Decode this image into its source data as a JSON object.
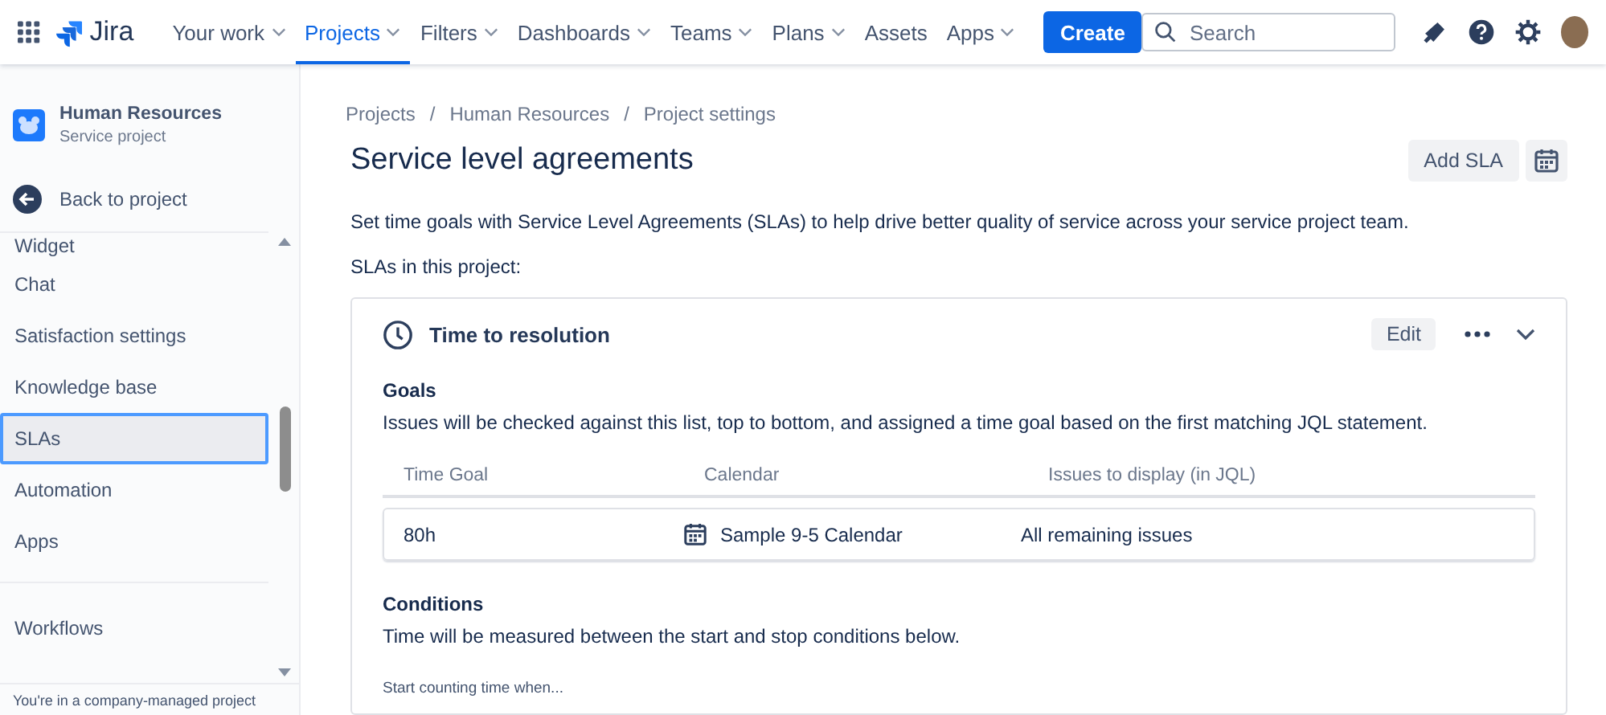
{
  "app": {
    "name": "Jira"
  },
  "nav": [
    {
      "label": "Your work",
      "dropdown": true,
      "selected": false
    },
    {
      "label": "Projects",
      "dropdown": true,
      "selected": true
    },
    {
      "label": "Filters",
      "dropdown": true,
      "selected": false
    },
    {
      "label": "Dashboards",
      "dropdown": true,
      "selected": false
    },
    {
      "label": "Teams",
      "dropdown": true,
      "selected": false
    },
    {
      "label": "Plans",
      "dropdown": true,
      "selected": false
    },
    {
      "label": "Assets",
      "dropdown": false,
      "selected": false
    },
    {
      "label": "Apps",
      "dropdown": true,
      "selected": false
    }
  ],
  "create_button": "Create",
  "search": {
    "placeholder": "Search"
  },
  "sidebar": {
    "project": {
      "name": "Human Resources",
      "type": "Service project"
    },
    "back": "Back to project",
    "items": [
      {
        "label": "Widget",
        "selected": false
      },
      {
        "label": "Chat",
        "selected": false
      },
      {
        "label": "Satisfaction settings",
        "selected": false
      },
      {
        "label": "Knowledge base",
        "selected": false
      },
      {
        "label": "SLAs",
        "selected": true
      },
      {
        "label": "Automation",
        "selected": false
      },
      {
        "label": "Apps",
        "selected": false
      }
    ],
    "group_2": [
      {
        "label": "Workflows",
        "selected": false
      }
    ],
    "footer": "You're in a company-managed project"
  },
  "breadcrumbs": [
    "Projects",
    "Human Resources",
    "Project settings"
  ],
  "breadcrumb_separator": "/",
  "page": {
    "title": "Service level agreements",
    "add_button": "Add SLA",
    "description": "Set time goals with Service Level Agreements (SLAs) to help drive better quality of service across your service project team.",
    "list_label": "SLAs in this project:"
  },
  "sla_cards": [
    {
      "title": "Time to resolution",
      "edit": "Edit",
      "expanded": true,
      "goals": {
        "heading": "Goals",
        "description": "Issues will be checked against this list, top to bottom, and assigned a time goal based on the first matching JQL statement.",
        "columns": [
          "Time Goal",
          "Calendar",
          "Issues to display (in JQL)"
        ],
        "rows": [
          {
            "time_goal": "80h",
            "calendar": "Sample 9-5 Calendar",
            "issues": "All remaining issues"
          }
        ]
      },
      "conditions": {
        "heading": "Conditions",
        "description": "Time will be measured between the start and stop conditions below.",
        "start_label": "Start counting time when..."
      }
    }
  ]
}
